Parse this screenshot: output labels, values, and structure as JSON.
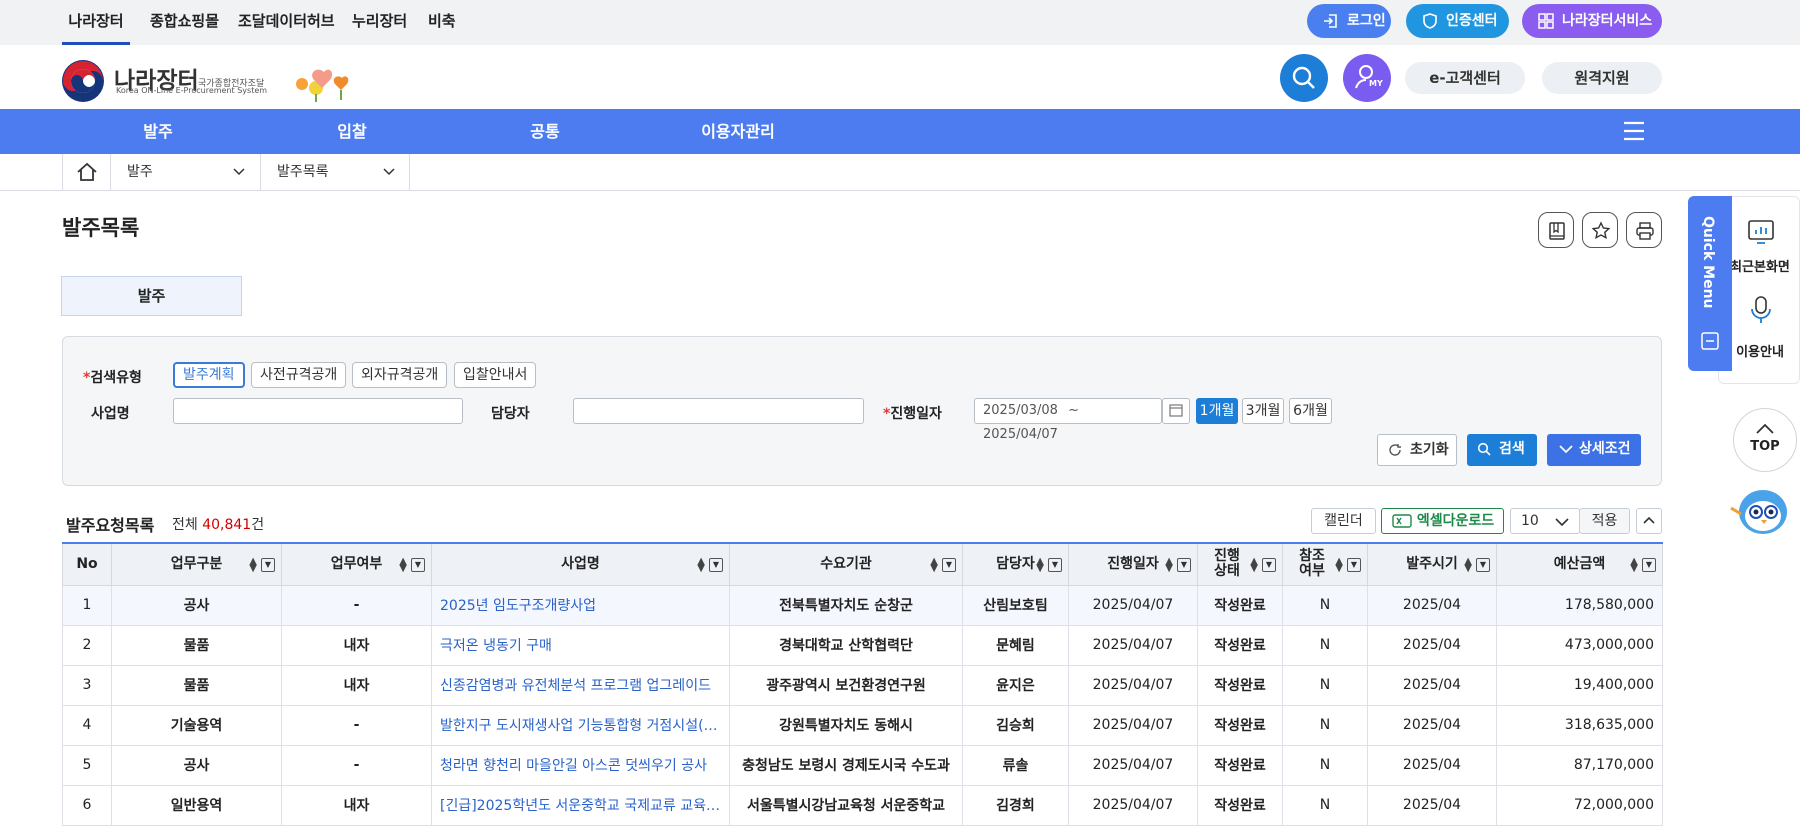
{
  "topbar": {
    "links": [
      "나라장터",
      "종합쇼핑몰",
      "조달데이터허브",
      "누리장터",
      "비축"
    ],
    "login": "로그인",
    "cert": "인증센터",
    "services": "나라장터서비스"
  },
  "header": {
    "logo_title": "나라장터",
    "logo_sub": "국가종합전자조달",
    "logo_en": "Korea ON-Line E-Procurement System",
    "my_label": "MY",
    "customer_center": "e-고객센터",
    "remote_support": "원격지원"
  },
  "nav": {
    "items": [
      "발주",
      "입찰",
      "공통",
      "이용자관리"
    ]
  },
  "breadcrumb": {
    "level1": "발주",
    "level2": "발주목록"
  },
  "page": {
    "title": "발주목록",
    "tab": "발주"
  },
  "search": {
    "type_label": "검색유형",
    "types": [
      "발주계획",
      "사전규격공개",
      "외자규격공개",
      "입찰안내서"
    ],
    "biz_label": "사업명",
    "manager_label": "담당자",
    "date_label": "진행일자",
    "date_from": "2025/03/08",
    "date_sep": "~",
    "date_to": "2025/04/07",
    "periods": [
      "1개월",
      "3개월",
      "6개월"
    ],
    "reset": "초기화",
    "search": "검색",
    "detail": "상세조건"
  },
  "list": {
    "title": "발주요청목록",
    "total_prefix": "전체",
    "total_count": "40,841",
    "total_suffix": "건",
    "calendar": "캘린더",
    "excel": "엑셀다운로드",
    "page_size": "10",
    "apply": "적용",
    "columns": [
      "No",
      "업무구분",
      "업무여부",
      "사업명",
      "수요기관",
      "담당자",
      "진행일자",
      "진행\n상태",
      "참조\n여부",
      "발주시기",
      "예산금액"
    ],
    "rows": [
      [
        "1",
        "공사",
        "-",
        "2025년 임도구조개량사업",
        "전북특별자치도 순창군",
        "산림보호팀",
        "2025/04/07",
        "작성완료",
        "N",
        "2025/04",
        "178,580,000"
      ],
      [
        "2",
        "물품",
        "내자",
        "극저온 냉동기 구매",
        "경북대학교 산학협력단",
        "문혜림",
        "2025/04/07",
        "작성완료",
        "N",
        "2025/04",
        "473,000,000"
      ],
      [
        "3",
        "물품",
        "내자",
        "신종감염병과 유전체분석 프로그램 업그레이드",
        "광주광역시 보건환경연구원",
        "윤지은",
        "2025/04/07",
        "작성완료",
        "N",
        "2025/04",
        "19,400,000"
      ],
      [
        "4",
        "기술용역",
        "-",
        "발한지구 도시재생사업 기능통합형 거점시설(…",
        "강원특별자치도 동해시",
        "김승희",
        "2025/04/07",
        "작성완료",
        "N",
        "2025/04",
        "318,635,000"
      ],
      [
        "5",
        "공사",
        "-",
        "청라면 향천리 마을안길 아스콘 덧씌우기 공사",
        "충청남도 보령시 경제도시국 수도과",
        "류솔",
        "2025/04/07",
        "작성완료",
        "N",
        "2025/04",
        "87,170,000"
      ],
      [
        "6",
        "일반용역",
        "내자",
        "[긴급]2025학년도 서운중학교 국제교류 교육…",
        "서울특별시강남교육청 서운중학교",
        "김경희",
        "2025/04/07",
        "작성완료",
        "N",
        "2025/04",
        "72,000,000"
      ]
    ]
  },
  "quick_menu": {
    "tab": "Quick Menu",
    "recent": "최근본화면",
    "guide": "이용안내",
    "top": "TOP"
  },
  "colors": {
    "nav_blue": "#4d7cf0",
    "login_blue": "#4a7ff0",
    "cert_blue": "#2196e0",
    "service_purple": "#8a5cf0",
    "link_blue": "#2a62c9"
  }
}
